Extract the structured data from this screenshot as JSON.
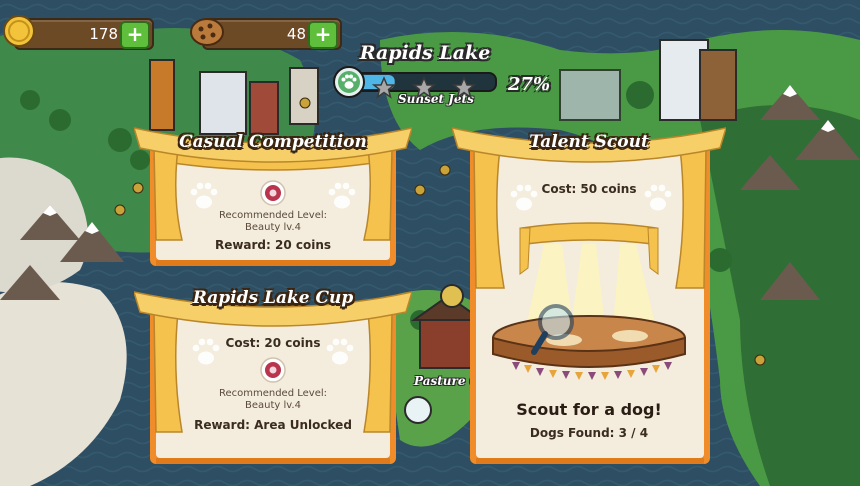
{
  "currencies": {
    "coins": {
      "value": "178",
      "icon": "coin-icon"
    },
    "treats": {
      "value": "48",
      "icon": "cookie-icon"
    }
  },
  "location": {
    "name": "Rapids Lake",
    "progress_percent": "27%",
    "progress": 0.27,
    "stars_total": 3,
    "nearby_label": "Sunset Jets",
    "map_label_2": "Pasture G"
  },
  "cards": {
    "casual": {
      "title": "Casual Competition",
      "recommended_label": "Recommended Level:",
      "recommended_value": "Beauty lv.4",
      "reward": "Reward: 20 coins"
    },
    "cup": {
      "title": "Rapids Lake Cup",
      "cost": "Cost: 20 coins",
      "recommended_label": "Recommended Level:",
      "recommended_value": "Beauty lv.4",
      "reward": "Reward: Area Unlocked"
    },
    "scout": {
      "title": "Talent Scout",
      "cost": "Cost: 50 coins",
      "action": "Scout for a dog!",
      "found": "Dogs Found: 3 / 4"
    }
  },
  "colors": {
    "paper": "#f4ecdc",
    "curtain": "#f5c24e",
    "frame_orange": "#f08c2a",
    "plus_green": "#5fbf3c",
    "progress_blue": "#4fb6e8"
  }
}
